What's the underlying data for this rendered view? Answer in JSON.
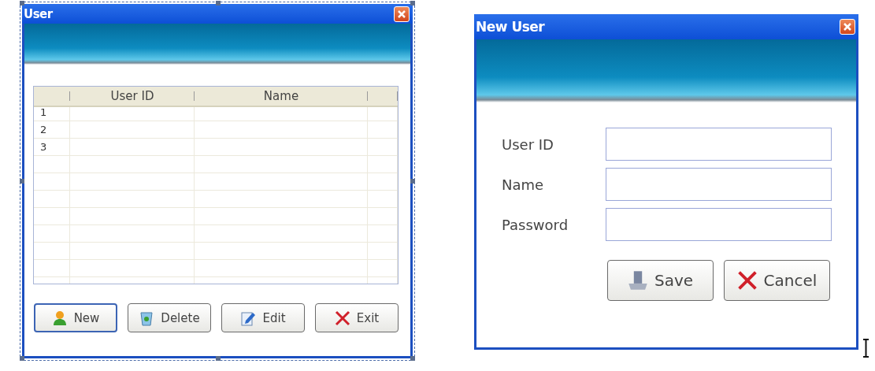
{
  "user_window": {
    "title": "User",
    "selected": true,
    "table": {
      "columns": [
        "User ID",
        "Name"
      ],
      "rows": [
        {
          "number": "1"
        },
        {
          "number": "2"
        },
        {
          "number": "3"
        }
      ]
    },
    "buttons": [
      {
        "kind": "new",
        "label": "New",
        "focused": true
      },
      {
        "kind": "delete",
        "label": "Delete",
        "focused": false
      },
      {
        "kind": "edit",
        "label": "Edit",
        "focused": false
      },
      {
        "kind": "exit",
        "label": "Exit",
        "focused": false
      }
    ]
  },
  "new_user_window": {
    "title": "New User",
    "fields": [
      {
        "label": "User ID"
      },
      {
        "label": "Name"
      },
      {
        "label": "Password"
      }
    ],
    "buttons": [
      {
        "kind": "save",
        "label": "Save",
        "focused": false
      },
      {
        "kind": "cancel",
        "label": "Cancel",
        "focused": false
      }
    ]
  }
}
